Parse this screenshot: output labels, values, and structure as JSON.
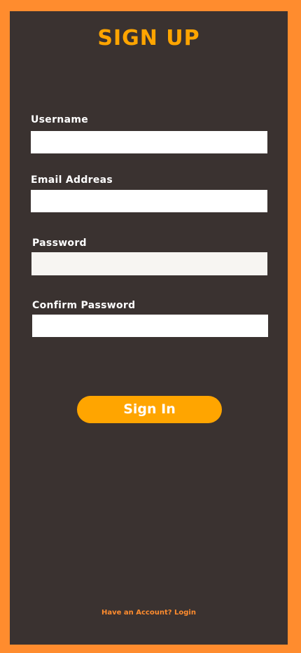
{
  "form": {
    "title": "SIGN UP",
    "fields": [
      {
        "label": "Username",
        "value": "",
        "placeholder": ""
      },
      {
        "label": "Email Addreas",
        "value": "",
        "placeholder": ""
      },
      {
        "label": "Password",
        "value": "",
        "placeholder": ""
      },
      {
        "label": "Confirm Password",
        "value": "",
        "placeholder": ""
      }
    ],
    "submit_label": "Sign In",
    "footer_text": "Have an Account? Login"
  },
  "colors": {
    "page_background": "#ff8c2e",
    "panel_background": "#3a3230",
    "accent": "#ffa500",
    "label_text": "#ffffff",
    "input_background": "#ffffff",
    "input_background_filled": "#f7f5f2"
  }
}
